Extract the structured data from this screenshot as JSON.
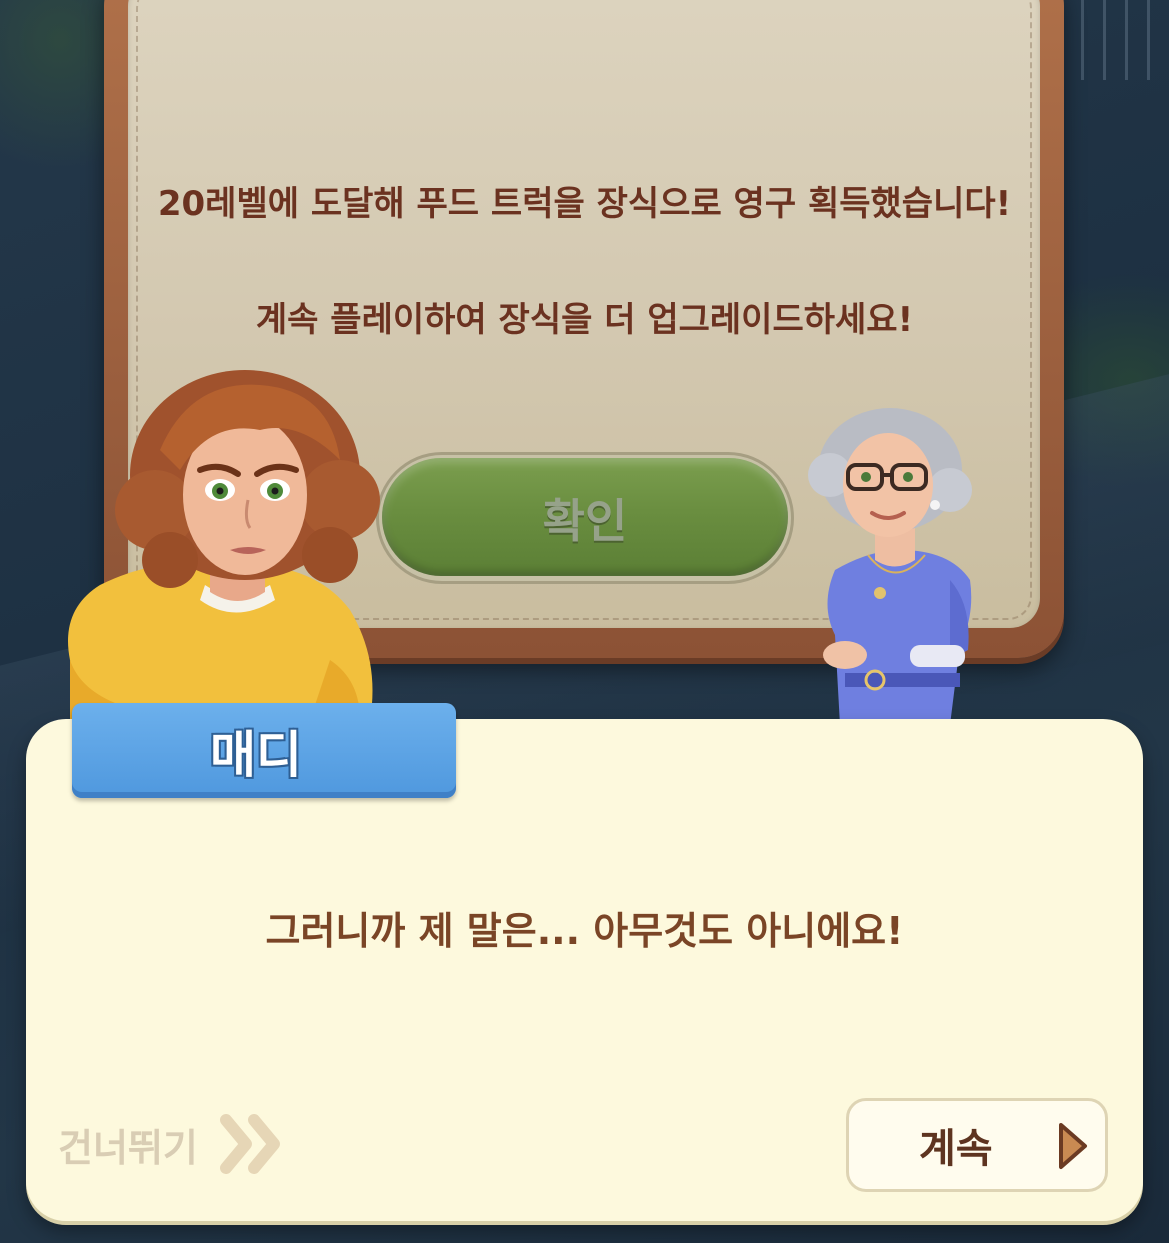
{
  "reward": {
    "line1": "20레벨에 도달해 푸드 트럭을 장식으로 영구 획득했습니다!",
    "line2": "계속 플레이하여 장식을 더 업그레이드하세요!",
    "confirm_label": "확인"
  },
  "dialogue": {
    "speaker": "매디",
    "text": "그러니까 제 말은... 아무것도 아니에요!",
    "skip_label": "건너뛰기",
    "continue_label": "계속"
  },
  "colors": {
    "frame": "#a0633f",
    "confirm": "#6a8e40",
    "name_tag": "#5aa1e4",
    "dialogue_bg": "#fdf9dd",
    "text_brown": "#7a4526"
  },
  "icons": {
    "skip": "double-chevron-right-icon",
    "continue": "play-triangle-icon"
  }
}
